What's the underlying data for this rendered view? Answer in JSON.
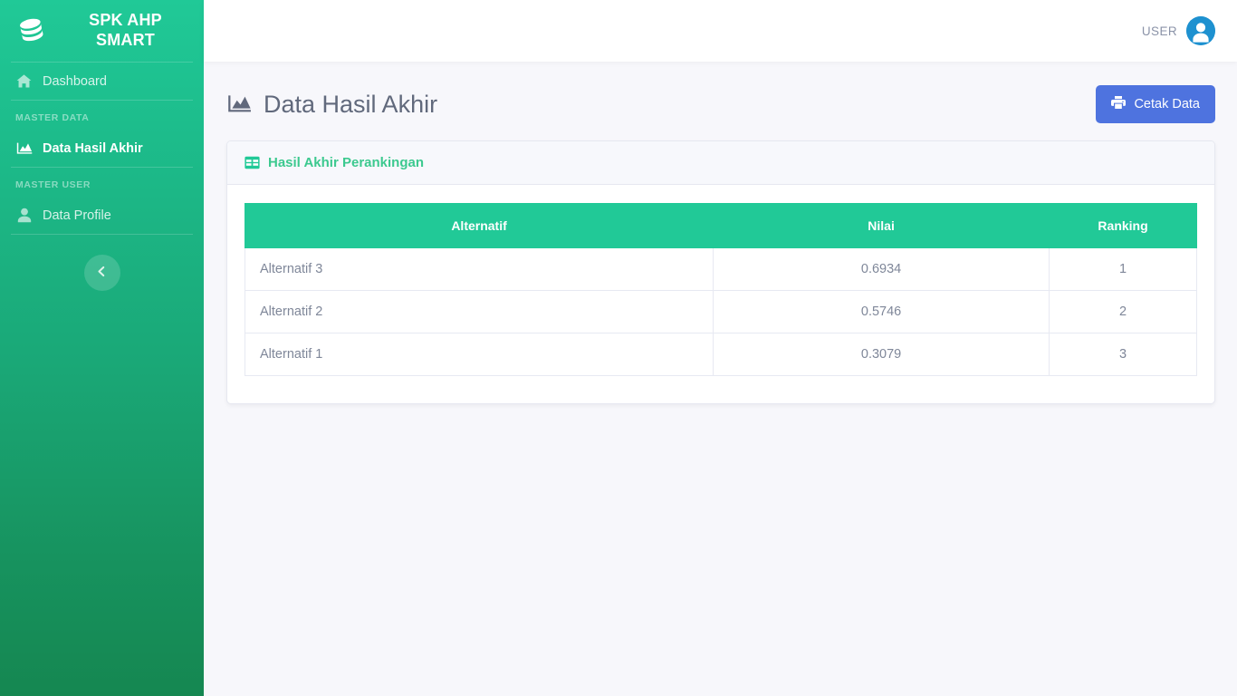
{
  "sidebar": {
    "brand": {
      "title": "SPK AHP SMART",
      "logo_icon": "database-icon"
    },
    "items": [
      {
        "label": "Dashboard",
        "icon": "home-icon",
        "active": false
      },
      {
        "label": "Data Hasil Akhir",
        "icon": "chart-area-icon",
        "active": true
      },
      {
        "label": "Data Profile",
        "icon": "user-icon",
        "active": false
      }
    ],
    "headings": {
      "master_data": "MASTER DATA",
      "master_user": "MASTER USER"
    },
    "collapse_icon": "chevron-left-icon"
  },
  "navbar": {
    "user_label": "USER",
    "avatar_icon": "user-avatar-icon"
  },
  "page": {
    "title": "Data Hasil Akhir",
    "title_icon": "chart-area-icon",
    "print_button": {
      "label": "Cetak Data",
      "icon": "print-icon"
    }
  },
  "card": {
    "header_title": "Hasil Akhir Perankingan",
    "header_icon": "table-icon"
  },
  "table": {
    "columns": [
      "Alternatif",
      "Nilai",
      "Ranking"
    ],
    "rows": [
      {
        "alternatif": "Alternatif 3",
        "nilai": "0.6934",
        "ranking": "1"
      },
      {
        "alternatif": "Alternatif 2",
        "nilai": "0.5746",
        "ranking": "2"
      },
      {
        "alternatif": "Alternatif 1",
        "nilai": "0.3079",
        "ranking": "3"
      }
    ]
  },
  "colors": {
    "sidebar_green_top": "#20c997",
    "sidebar_green_bottom": "#158751",
    "table_header_green": "#21c997",
    "accent_blue": "#4e73df",
    "avatar_blue": "#1e91d0",
    "page_background": "#f7f7fb"
  }
}
